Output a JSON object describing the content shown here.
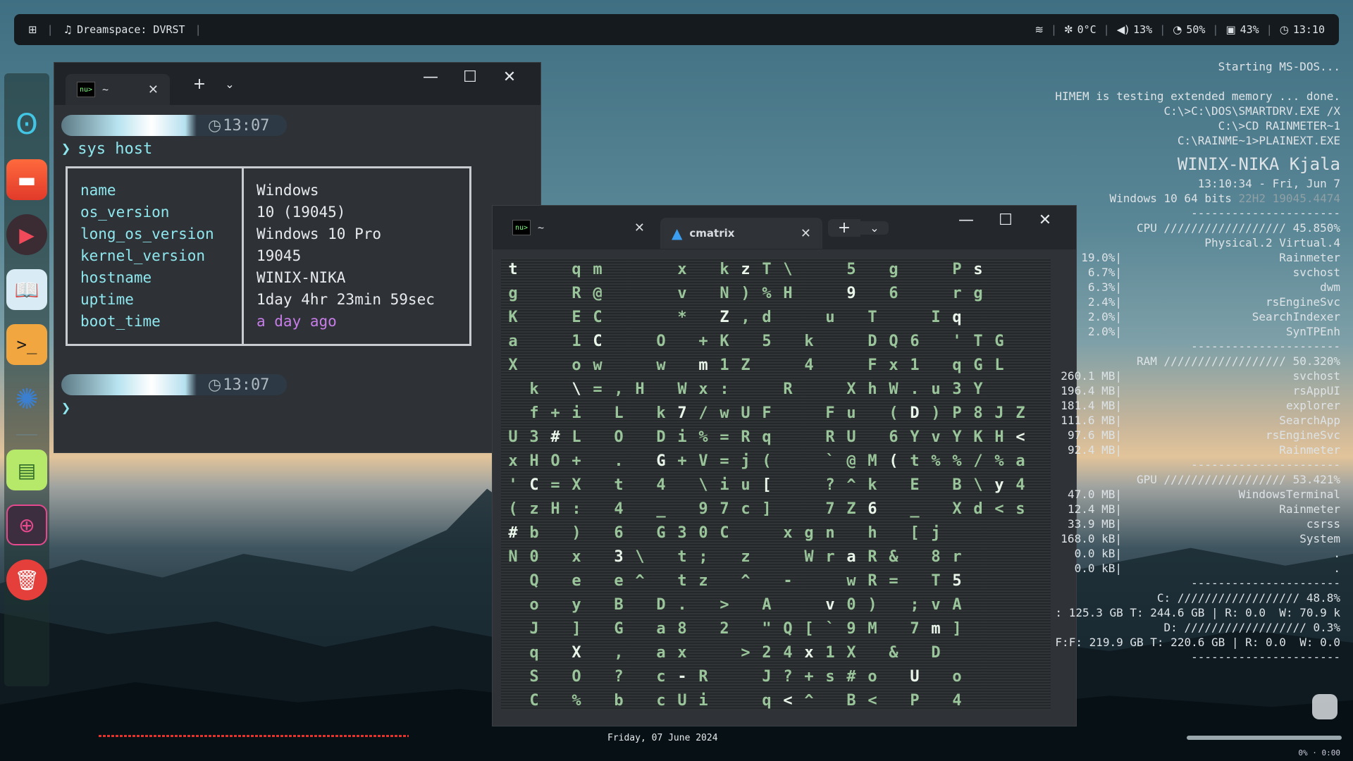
{
  "topbar": {
    "now_playing": "Dreamspace: DVRST",
    "weather": "0°C",
    "volume": "13%",
    "battery": "50%",
    "cpu": "43%",
    "clock": "13:10"
  },
  "term1": {
    "tab_title": "~",
    "prompt_time": "13:07",
    "command": "sys host",
    "keys": [
      "name",
      "os_version",
      "long_os_version",
      "kernel_version",
      "hostname",
      "uptime",
      "boot_time"
    ],
    "values": [
      "Windows",
      "10 (19045)",
      "Windows 10 Pro",
      "19045",
      "WINIX-NIKA",
      "1day 4hr 23min 59sec",
      "a day ago"
    ],
    "prompt_time_2": "13:07",
    "chev": "❯"
  },
  "term2": {
    "tab1_title": "~",
    "tab2_title": "cmatrix",
    "matrix_rows": [
      "t  qm   x kzT\\  5 g  Ps",
      "g  R@   v N)%H  9 6  rg",
      "K  EC   * Z,d  u T  Iq",
      "a  1C  O +K 5 k  DQ6 'TG",
      "X  ow  w m1Z  4  Fx1 qGL",
      " k \\=,H Wx:  R  XhW.u3Y",
      " f+i L k7/wUF  Fu (D)P8JZ",
      "U3#L O Di%=Rq  RU 6YvYKH<",
      "xHO+ . G+V=j(  `@M(t%%/%a",
      "'C=X t 4 \\iu[  ?^k E B\\y4",
      "(zH: 4 _ 97c]  7Z6 _ Xd<s",
      "#b ) 6 G30C  xgn h [j",
      "N0 x 3\\ t; z  WraR& 8r",
      " Q e e^ tz ^ -  wR= T5",
      " o y B D. > A  v0) ;vA",
      " J ] G a8 2 \"Q[`9M 7m]",
      " q X , ax  >24x1X & D",
      " S O ? c-R  J?+s#o U o",
      " C % b cUi  q<^ B< P 4"
    ]
  },
  "rainmeter": {
    "boot_lines": [
      "Starting MS-DOS...",
      "",
      "HIMEM is testing extended memory ... done.",
      "C:\\>C:\\DOS\\SMARTDRV.EXE /X",
      "C:\\>CD RAINMETER~1",
      "C:\\RAINME~1>PLAINEXT.EXE"
    ],
    "host": "WINIX-NIKA Kjala",
    "datetime": "13:10:34 - Fri, Jun 7",
    "os": "Windows 10 64 bits",
    "os_build": "22H2 19045.4474",
    "divider": "----------------------",
    "cpu_line": "CPU ////////////////// 45.850%",
    "cpu_sub": "Physical.2 Virtual.4",
    "cpu_procs": [
      [
        "19.0%|",
        "Rainmeter"
      ],
      [
        "6.7%|",
        "svchost"
      ],
      [
        "6.3%|",
        "dwm"
      ],
      [
        "2.4%|",
        "rsEngineSvc"
      ],
      [
        "2.0%|",
        "SearchIndexer"
      ],
      [
        "2.0%|",
        "SynTPEnh"
      ]
    ],
    "ram_line": "RAM ////////////////// 50.320%",
    "ram_procs": [
      [
        "260.1 MB|",
        "svchost"
      ],
      [
        "196.4 MB|",
        "rsAppUI"
      ],
      [
        "181.4 MB|",
        "explorer"
      ],
      [
        "111.6 MB|",
        "SearchApp"
      ],
      [
        "97.6 MB|",
        "rsEngineSvc"
      ],
      [
        "92.4 MB|",
        "Rainmeter"
      ]
    ],
    "gpu_line": "GPU ////////////////// 53.421%",
    "gpu_procs": [
      [
        "47.0 MB|",
        "WindowsTerminal"
      ],
      [
        "12.4 MB|",
        "Rainmeter"
      ],
      [
        "33.9 MB|",
        "csrss"
      ],
      [
        "168.0 kB|",
        "System"
      ],
      [
        "0.0 kB|",
        "."
      ],
      [
        "0.0 kB|",
        "."
      ]
    ],
    "disk_c": "C: ////////////////// 48.8%",
    "disk_c_detail": ": 125.3 GB T: 244.6 GB | R: 0.0  W: 70.9 k",
    "disk_d": "D: ////////////////// 0.3%",
    "disk_d_detail": "F:F: 219.9 GB T: 220.6 GB | R: 0.0  W: 0.0",
    "bottom_small": "0%",
    "bottom_clock": "0:00"
  },
  "footer": {
    "date": "Friday, 07  June  2024"
  }
}
